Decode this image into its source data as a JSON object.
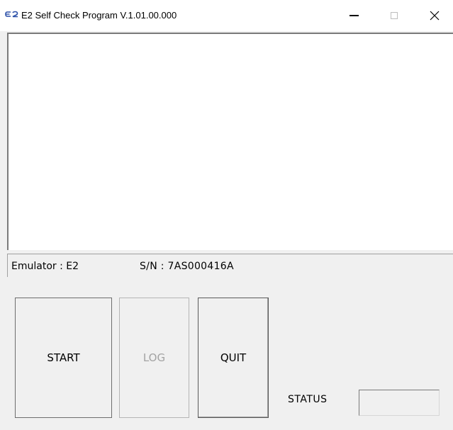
{
  "window": {
    "icon_text": "E2",
    "title": "E2 Self Check Program V.1.01.00.000",
    "controls": {
      "minimize": "minimize-icon",
      "maximize": "maximize-icon",
      "close": "×"
    }
  },
  "output": {
    "text": ""
  },
  "info": {
    "emulator": "Emulator : E2",
    "serial": "S/N : 7AS000416A"
  },
  "buttons": {
    "start": "START",
    "log": "LOG",
    "quit": "QUIT"
  },
  "status": {
    "label": "STATUS",
    "value": ""
  },
  "colors": {
    "window_bg": "#f0f0f0",
    "titlebar_bg": "#ffffff",
    "icon_blue": "#2a4fa8",
    "disabled_text": "#a3a3a3"
  }
}
